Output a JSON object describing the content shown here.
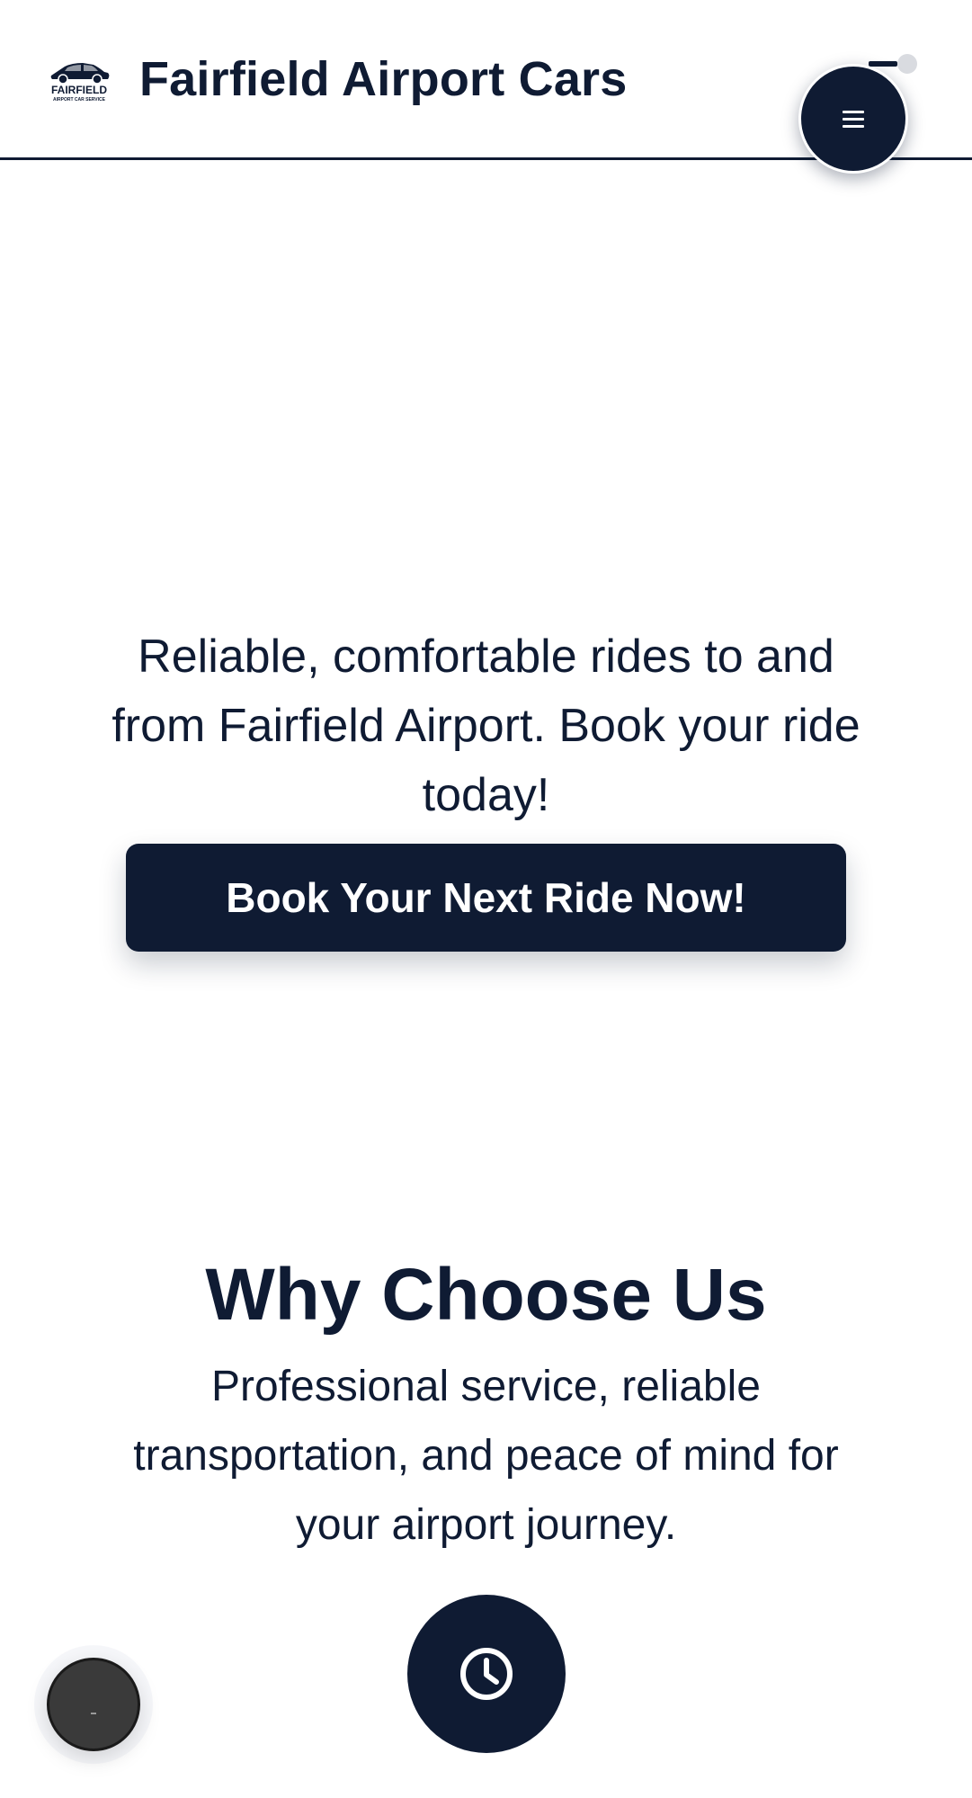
{
  "header": {
    "logo_text": "FAIRFIELD",
    "logo_subtext": "AIRPORT CAR SERVICE",
    "site_title": "Fairfield Airport Cars",
    "menu_icon": "hamburger-menu-icon"
  },
  "hero": {
    "tagline": "Reliable, comfortable rides to and from Fairfield Airport. Book your ride today!",
    "cta_label": "Book Your Next Ride Now!"
  },
  "why_choose_us": {
    "title": "Why Choose Us",
    "description": "Professional service, reliable transportation, and peace of mind for your airport journey.",
    "feature_icon": "clock-icon"
  },
  "chat_widget": {
    "icon": "chat-icon"
  },
  "colors": {
    "brand_navy": "#0f1b33",
    "background": "#ffffff",
    "chat_button": "#3a3a3a"
  }
}
